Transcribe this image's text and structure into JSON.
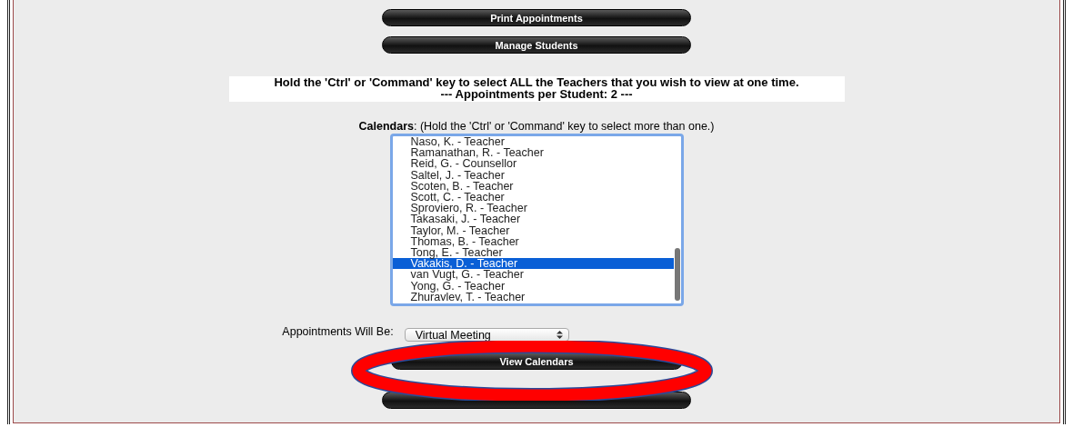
{
  "top_buttons": [
    {
      "label": "Print Appointments"
    },
    {
      "label": "Manage Students"
    }
  ],
  "instructions": {
    "line_1": "Hold the 'Ctrl' or 'Command' key to select ALL the Teachers that you wish to view at one time.",
    "line_2": "--- Appointments per Student: 2 ---"
  },
  "calendars": {
    "label": "Calendars",
    "hint": ": (Hold the 'Ctrl' or 'Command' key to select more than one.)",
    "items": [
      {
        "label": "Naso, K. - Teacher",
        "selected": false
      },
      {
        "label": "Ramanathan, R. - Teacher",
        "selected": false
      },
      {
        "label": "Reid, G. - Counsellor",
        "selected": false
      },
      {
        "label": "Saltel, J. - Teacher",
        "selected": false
      },
      {
        "label": "Scoten, B. - Teacher",
        "selected": false
      },
      {
        "label": "Scott, C. - Teacher",
        "selected": false
      },
      {
        "label": "Sproviero, R. - Teacher",
        "selected": false
      },
      {
        "label": "Takasaki, J. - Teacher",
        "selected": false
      },
      {
        "label": "Taylor, M. - Teacher",
        "selected": false
      },
      {
        "label": "Thomas, B. - Teacher",
        "selected": false
      },
      {
        "label": "Tong, E. - Teacher",
        "selected": false
      },
      {
        "label": "Vakakis, D. - Teacher",
        "selected": true
      },
      {
        "label": "van Vugt, G. - Teacher",
        "selected": false
      },
      {
        "label": "Yong, G. - Teacher",
        "selected": false
      },
      {
        "label": "Zhuravlev, T. - Teacher",
        "selected": false
      }
    ]
  },
  "appointment_type": {
    "label": "Appointments Will Be:",
    "value": "Virtual Meeting"
  },
  "view_button": {
    "label": "View Calendars"
  }
}
